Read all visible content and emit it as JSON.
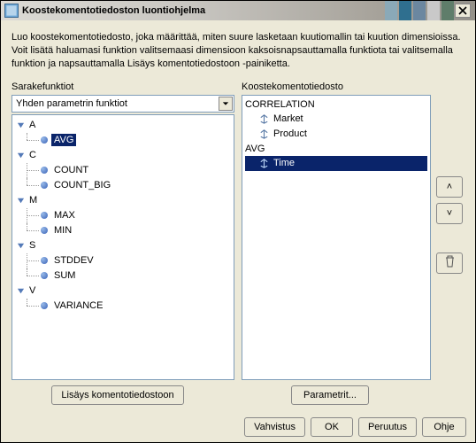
{
  "window": {
    "title": "Koostekomentotiedoston luontiohjelma"
  },
  "intro": "Luo koostekomentotiedosto, joka määrittää, miten suure lasketaan kuutiomallin tai kuution dimensioissa. Voit lisätä haluamasi funktion valitsemaasi dimensioon kaksoisnapsauttamalla funktiota tai valitsemalla funktion ja napsauttamalla Lisäys komentotiedostoon -painiketta.",
  "left": {
    "label": "Sarakefunktiot",
    "combo_value": "Yhden parametrin funktiot",
    "groups": [
      {
        "letter": "A",
        "items": [
          "AVG"
        ],
        "selected_index": 0
      },
      {
        "letter": "C",
        "items": [
          "COUNT",
          "COUNT_BIG"
        ]
      },
      {
        "letter": "M",
        "items": [
          "MAX",
          "MIN"
        ]
      },
      {
        "letter": "S",
        "items": [
          "STDDEV",
          "SUM"
        ]
      },
      {
        "letter": "V",
        "items": [
          "VARIANCE"
        ]
      }
    ],
    "add_button": "Lisäys komentotiedostoon"
  },
  "right": {
    "label": "Koostekomentotiedosto",
    "groups": [
      {
        "name": "CORRELATION",
        "items": [
          "Market",
          "Product"
        ]
      },
      {
        "name": "AVG",
        "items": [
          "Time"
        ],
        "selected_index": 0
      }
    ],
    "params_button": "Parametrit...",
    "move_up": "˄",
    "move_down": "˅"
  },
  "buttons": {
    "vahvistus": "Vahvistus",
    "ok": "OK",
    "peruutus": "Peruutus",
    "ohje": "Ohje"
  }
}
